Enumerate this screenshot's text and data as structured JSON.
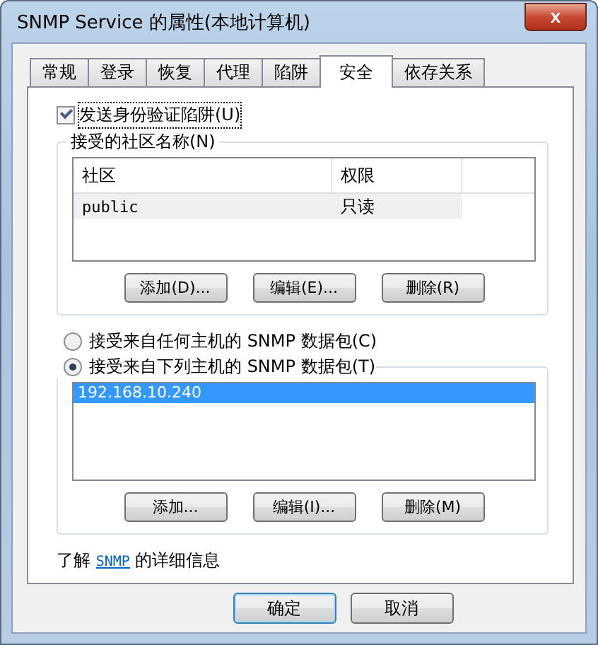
{
  "window": {
    "title": "SNMP Service 的属性(本地计算机)",
    "close": "x"
  },
  "tabs": [
    {
      "label": "常规",
      "selected": false
    },
    {
      "label": "登录",
      "selected": false
    },
    {
      "label": "恢复",
      "selected": false
    },
    {
      "label": "代理",
      "selected": false
    },
    {
      "label": "陷阱",
      "selected": false
    },
    {
      "label": "安全",
      "selected": true
    },
    {
      "label": "依存关系",
      "selected": false
    }
  ],
  "auth_trap": {
    "label": "发送身份验证陷阱(U)",
    "checked": true
  },
  "communities": {
    "title": "接受的社区名称(N)",
    "columns": [
      "社区",
      "权限"
    ],
    "rows": [
      {
        "cells": [
          "public",
          "只读"
        ],
        "selected": false
      }
    ],
    "buttons": [
      "添加(D)...",
      "编辑(E)...",
      "删除(R)"
    ]
  },
  "hosts_mode": [
    {
      "label": "接受来自任何主机的 SNMP 数据包(C)",
      "selected": false
    },
    {
      "label": "接受来自下列主机的 SNMP 数据包(T)",
      "selected": true
    }
  ],
  "hosts": {
    "items": [
      {
        "label": "192.168.10.240",
        "selected": true
      }
    ],
    "buttons": [
      "添加...",
      "编辑(I)...",
      "删除(M)"
    ]
  },
  "learn_more": {
    "prefix": "了解",
    "link": "SNMP",
    "suffix": "的详细信息"
  },
  "dialog_buttons": [
    "确定",
    "取消"
  ]
}
